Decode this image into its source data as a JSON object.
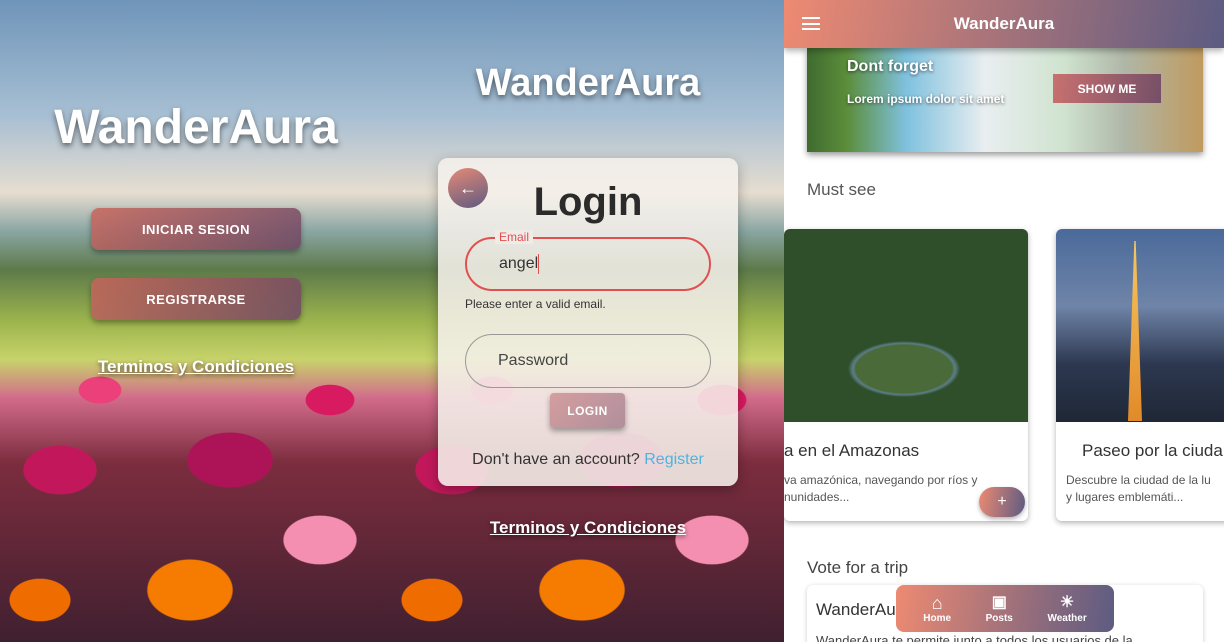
{
  "welcome": {
    "title": "WanderAura",
    "login_button": "INICIAR SESION",
    "register_button": "REGISTRARSE",
    "terms_link": "Terminos y Condiciones"
  },
  "login": {
    "app_title": "WanderAura",
    "heading": "Login",
    "email_label": "Email",
    "email_value": "angel",
    "email_error": "Please enter a valid email.",
    "password_placeholder": "Password",
    "login_button": "LOGIN",
    "no_account_text": "Don't have an account?",
    "register_link": "Register",
    "terms_link": "Terminos y Condiciones"
  },
  "home": {
    "header_title": "WanderAura",
    "banner": {
      "title": "Dont forget",
      "subtitle": "Lorem ipsum dolor sit amet",
      "button": "SHOW ME"
    },
    "must_see_heading": "Must see",
    "trips": [
      {
        "title": "a en el Amazonas",
        "description_line1": "va amazónica, navegando por ríos y",
        "description_line2": "nunidades..."
      },
      {
        "title": "Paseo por la ciuda",
        "description_line1": "Descubre la ciudad de la lu",
        "description_line2": "y lugares emblemáti..."
      }
    ],
    "add_button": "+",
    "vote_heading": "Vote for a trip",
    "vote_card": {
      "title": "WanderAura",
      "text": "WanderAura te permite junto a todos los usuarios de la"
    },
    "nav": [
      {
        "label": "Home",
        "icon": "home-icon"
      },
      {
        "label": "Posts",
        "icon": "image-icon"
      },
      {
        "label": "Weather",
        "icon": "sun-icon"
      }
    ]
  },
  "colors": {
    "gradient_start": "#ee8a72",
    "gradient_end": "#5c5b82",
    "error": "#e05050",
    "link": "#4fb3e0"
  }
}
